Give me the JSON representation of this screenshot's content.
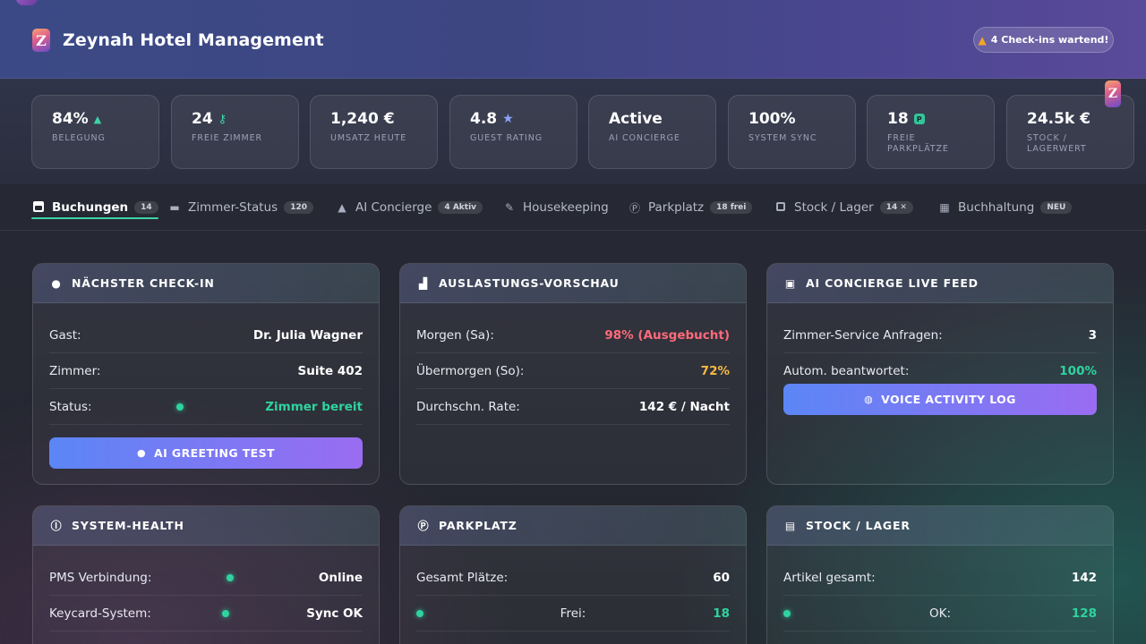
{
  "header": {
    "title": "Zeynah Hotel Management",
    "logo_letter": "Z",
    "checkin_badge": "4 Check-ins wartend!"
  },
  "stats": [
    {
      "value": "84%",
      "label": "Belegung",
      "icon": "up-arrow-icon"
    },
    {
      "value": "24",
      "label": "Freie Zimmer",
      "icon": "key-icon"
    },
    {
      "value": "1,240 €",
      "label": "Umsatz heute"
    },
    {
      "value": "4.8",
      "label": "Guest Rating",
      "icon": "star-icon"
    },
    {
      "value": "Active",
      "label": "AI Concierge"
    },
    {
      "value": "100%",
      "label": "System Sync"
    },
    {
      "value": "18",
      "label": "Freie Parkplätze",
      "icon": "parking-icon"
    },
    {
      "value": "24.5k €",
      "label": "Stock / Lagerwert"
    }
  ],
  "tabs": [
    {
      "label": "Buchungen",
      "badge": "14",
      "active": true
    },
    {
      "label": "Zimmer-Status",
      "badge": "120"
    },
    {
      "label": "AI Concierge",
      "badge": "4 Aktiv"
    },
    {
      "label": "Housekeeping"
    },
    {
      "label": "Parkplatz",
      "badge": "18 frei"
    },
    {
      "label": "Stock / Lager",
      "badge": "14 ✕"
    },
    {
      "label": "Buchhaltung",
      "badge": "NEU"
    }
  ],
  "checkin_card": {
    "title": "Nächster Check-in",
    "rows": [
      {
        "label": "Gast:",
        "value": "Dr. Julia Wagner"
      },
      {
        "label": "Zimmer:",
        "value": "Suite 402"
      },
      {
        "label": "Status:",
        "value": "Zimmer bereit"
      }
    ],
    "button": "AI GREETING TEST"
  },
  "forecast_card": {
    "title": "Auslastungs-Vorschau",
    "rows": [
      {
        "label": "Morgen (Sa):",
        "value": "98% (Ausgebucht)"
      },
      {
        "label": "Übermorgen (So):",
        "value": "72%"
      },
      {
        "label": "Durchschn. Rate:",
        "value": "142 € / Nacht"
      }
    ]
  },
  "concierge_card": {
    "title": "AI Concierge Live Feed",
    "rows": [
      {
        "label": "Zimmer-Service Anfragen:",
        "value": "3"
      },
      {
        "label": "Autom. beantwortet:",
        "value": "100%"
      }
    ],
    "button": "VOICE ACTIVITY LOG"
  },
  "health_card": {
    "title": "System-Health",
    "rows": [
      {
        "label": "PMS Verbindung:",
        "value": "Online"
      },
      {
        "label": "Keycard-System:",
        "value": "Sync OK"
      }
    ]
  },
  "parking_card": {
    "title": "Parkplatz",
    "rows": [
      {
        "label": "Gesamt Plätze:",
        "value": "60"
      },
      {
        "label": "Frei:",
        "value": "18"
      }
    ]
  },
  "stock_card": {
    "title": "Stock / Lager",
    "rows": [
      {
        "label": "Artikel gesamt:",
        "value": "142"
      },
      {
        "label": "OK:",
        "value": "128"
      }
    ]
  },
  "colors": {
    "accent_green": "#2fd39f",
    "alert_red": "#ff6b7a",
    "warn_amber": "#f5b942",
    "button_gradient_start": "#5b86f6",
    "button_gradient_end": "#9a6cf2"
  }
}
